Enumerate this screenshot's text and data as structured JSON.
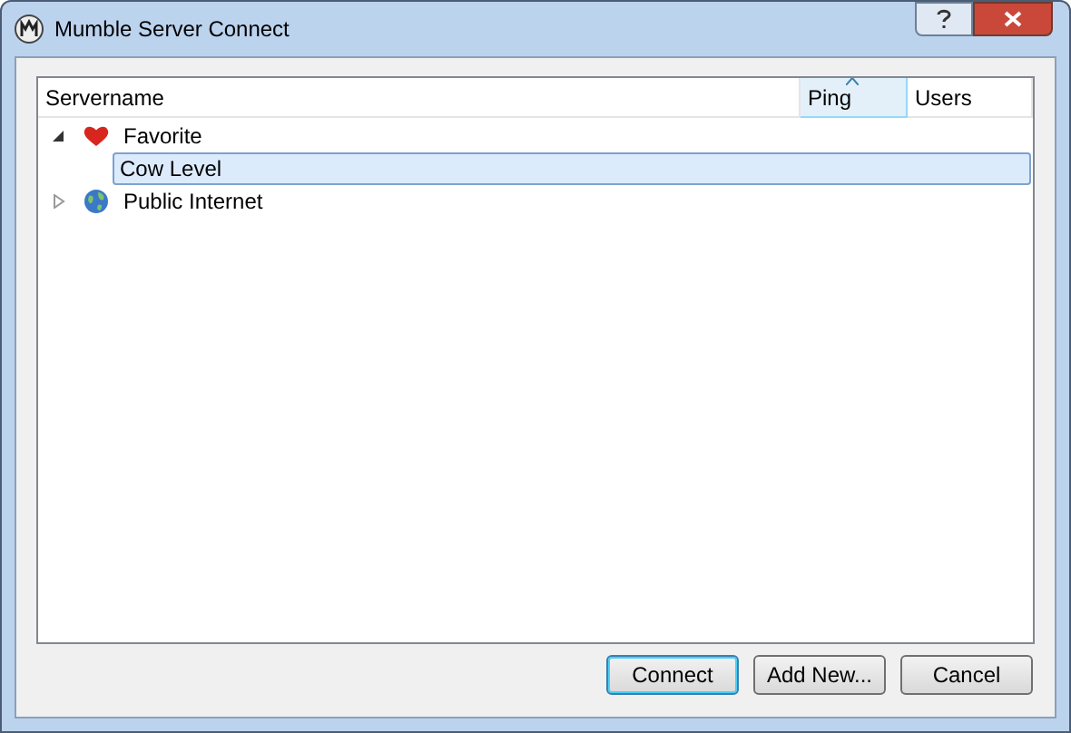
{
  "window": {
    "title": "Mumble Server Connect"
  },
  "table": {
    "columns": [
      {
        "label": "Servername",
        "sorted": false
      },
      {
        "label": "Ping",
        "sorted": true
      },
      {
        "label": "Users",
        "sorted": false
      }
    ],
    "tree": [
      {
        "label": "Favorite",
        "kind": "heart",
        "expanded": true,
        "selected": false,
        "children": [
          {
            "label": "Cow Level",
            "kind": "server",
            "selected": true
          }
        ]
      },
      {
        "label": "Public Internet",
        "kind": "globe",
        "expanded": false,
        "selected": false
      }
    ]
  },
  "buttons": [
    {
      "label": "Connect",
      "default": true
    },
    {
      "label": "Add New...",
      "default": false
    },
    {
      "label": "Cancel",
      "default": false
    }
  ]
}
